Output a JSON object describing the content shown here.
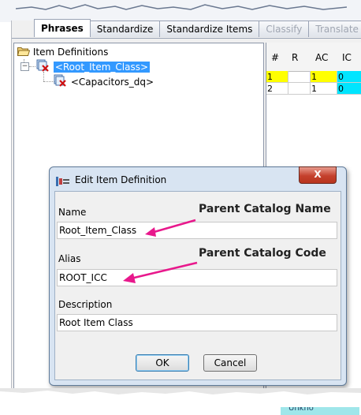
{
  "tabs": [
    {
      "label": "Phrases",
      "state": "active"
    },
    {
      "label": "Standardize",
      "state": "normal"
    },
    {
      "label": "Standardize Items",
      "state": "normal"
    },
    {
      "label": "Classify",
      "state": "disabled"
    },
    {
      "label": "Translate",
      "state": "disabled"
    }
  ],
  "tree": {
    "root_label": "Item Definitions",
    "selected_item": "<Root_Item_Class>",
    "child_item": "<Capacitors_dq>"
  },
  "grid": {
    "headers": [
      "#",
      "R",
      "AC",
      "IC"
    ],
    "rows": [
      {
        "num": "1",
        "r": "",
        "ac": "1",
        "ic": "0"
      },
      {
        "num": "2",
        "r": "",
        "ac": "1",
        "ic": "0"
      }
    ],
    "bottom_text": "Unkno"
  },
  "dialog": {
    "title": "Edit Item Definition",
    "close_label": "X",
    "fields": {
      "name_label": "Name",
      "name_value": "Root_Item_Class",
      "alias_label": "Alias",
      "alias_value": "ROOT_ICC",
      "description_label": "Description",
      "description_value": "Root Item Class"
    },
    "annotations": {
      "name_hint": "Parent Catalog Name",
      "alias_hint": "Parent Catalog Code",
      "arrow_color": "#e8188c"
    },
    "ok_label": "OK",
    "cancel_label": "Cancel"
  }
}
